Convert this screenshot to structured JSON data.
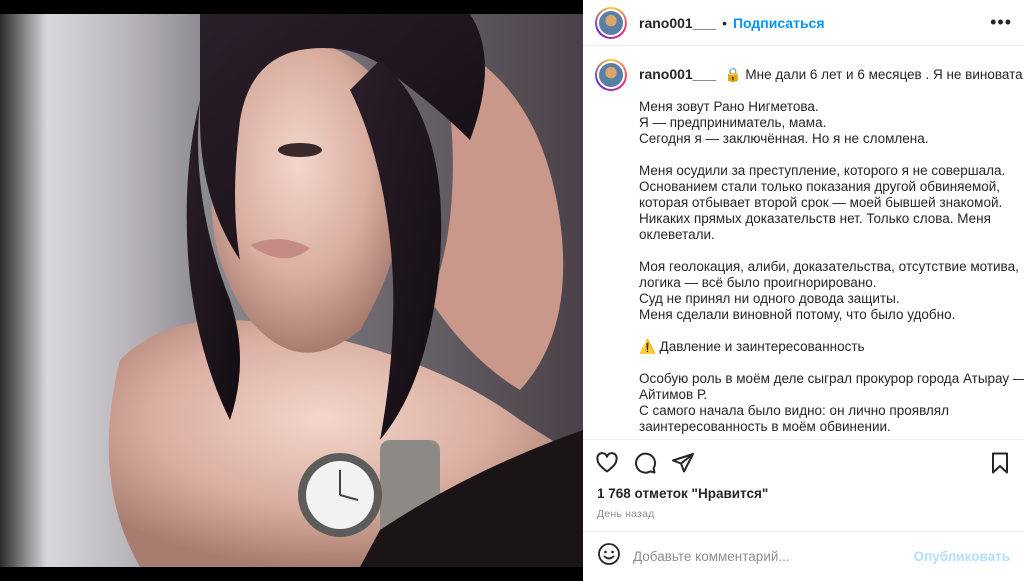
{
  "post": {
    "username": "rano001___",
    "follow_label": "Подписаться",
    "separator": "•",
    "more_label": "•••"
  },
  "caption": {
    "username": "rano001___",
    "lock_emoji": "🔒",
    "headline": "Мне дали 6 лет и 6 месяцев . Я не виновата.",
    "paragraphs": [
      [
        "Меня зовут Рано Нигметова.",
        "Я — предприниматель, мама.",
        "Сегодня я — заключённая. Но я не сломлена."
      ],
      [
        "Меня осудили за преступление, которого я не совершала.",
        "Основанием стали только показания другой обвиняемой,",
        "которая отбывает второй срок — моей бывшей знакомой.",
        "Никаких прямых доказательств нет. Только слова. Меня",
        "оклеветали."
      ],
      [
        "Моя геолокация, алиби, доказательства, отсутствие мотива,",
        "логика — всё было проигнорировано.",
        "Суд не принял ни одного довода защиты.",
        "Меня сделали виновной потому, что было удобно."
      ],
      [
        "⚠️ Давление и заинтересованность"
      ],
      [
        "Особую роль в моём деле сыграл прокурор города Атырау —",
        "Айтимов Р.",
        "С самого начала было видно: он лично проявлял",
        "заинтересованность в моём обвинении."
      ]
    ]
  },
  "engagement": {
    "likes_text": "1 768 отметок \"Нравится\"",
    "time_text": "День назад"
  },
  "comment_box": {
    "placeholder": "Добавьте комментарий...",
    "publish_label": "Опубликовать"
  },
  "icons": {
    "like": "heart-icon",
    "comment": "comment-icon",
    "share": "share-icon",
    "save": "bookmark-icon",
    "emoji": "emoji-icon"
  },
  "colors": {
    "accent": "#0095f6",
    "publish_disabled": "#b2dffc",
    "muted": "#8e8e8e"
  }
}
